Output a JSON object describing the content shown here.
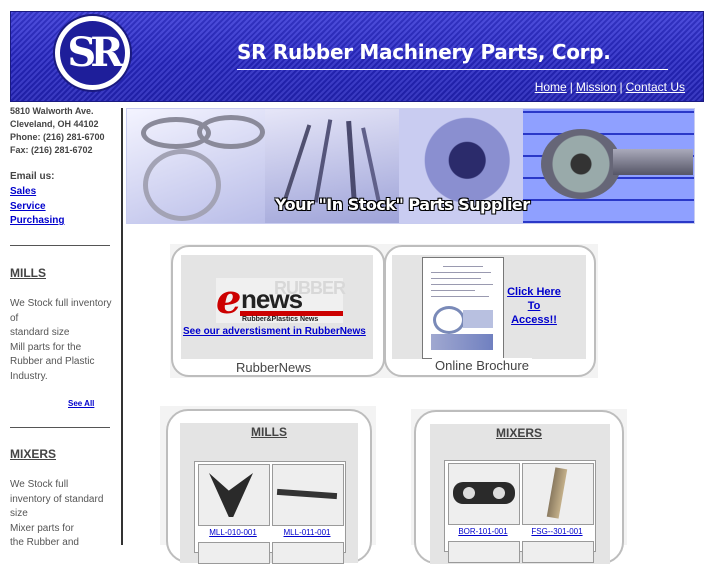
{
  "header": {
    "logo_text": "SR",
    "company": "SR Rubber Machinery Parts, Corp.",
    "nav": [
      "Home",
      "Mission",
      "Contact Us"
    ],
    "nav_separator": "|"
  },
  "sidebar": {
    "address": [
      "5810 Walworth Ave.",
      "Cleveland, OH 44102",
      "Phone: (216) 281-6700",
      "Fax: (216) 281-6702"
    ],
    "email_heading": "Email us:",
    "email_links": [
      "Sales",
      "Service",
      "Purchasing"
    ],
    "sections": [
      {
        "title": "MILLS",
        "lines": [
          "We Stock full inventory",
          "of",
          "standard size",
          "Mill parts for the",
          "Rubber and Plastic",
          "Industry."
        ],
        "see_all": "See All"
      },
      {
        "title": "MIXERS",
        "lines": [
          "We Stock full",
          "inventory of standard",
          "size",
          "Mixer parts for",
          "the Rubber and"
        ]
      }
    ]
  },
  "banner": {
    "tagline": "Your \"In Stock\" Parts Supplier"
  },
  "features": {
    "rubbernews": {
      "logo_e": "e",
      "logo_news": "news",
      "logo_back": "RUBBER",
      "logo_sub": "Rubber&Plastics News",
      "link": "See our adverstisment in RubberNews",
      "caption": "RubberNews"
    },
    "brochure": {
      "link_lines": [
        "Click Here",
        "To",
        "Access!!"
      ],
      "caption": "Online Brochure"
    }
  },
  "products": {
    "mills": {
      "title": "MILLS",
      "items": [
        "MLL-010-001",
        "MLL-011-001"
      ]
    },
    "mixers": {
      "title": "MIXERS",
      "items": [
        "BOR-101-001",
        "FSG--301-001"
      ]
    }
  },
  "colors": {
    "header_blue": "#2727c4",
    "link_blue": "#0000cc"
  }
}
